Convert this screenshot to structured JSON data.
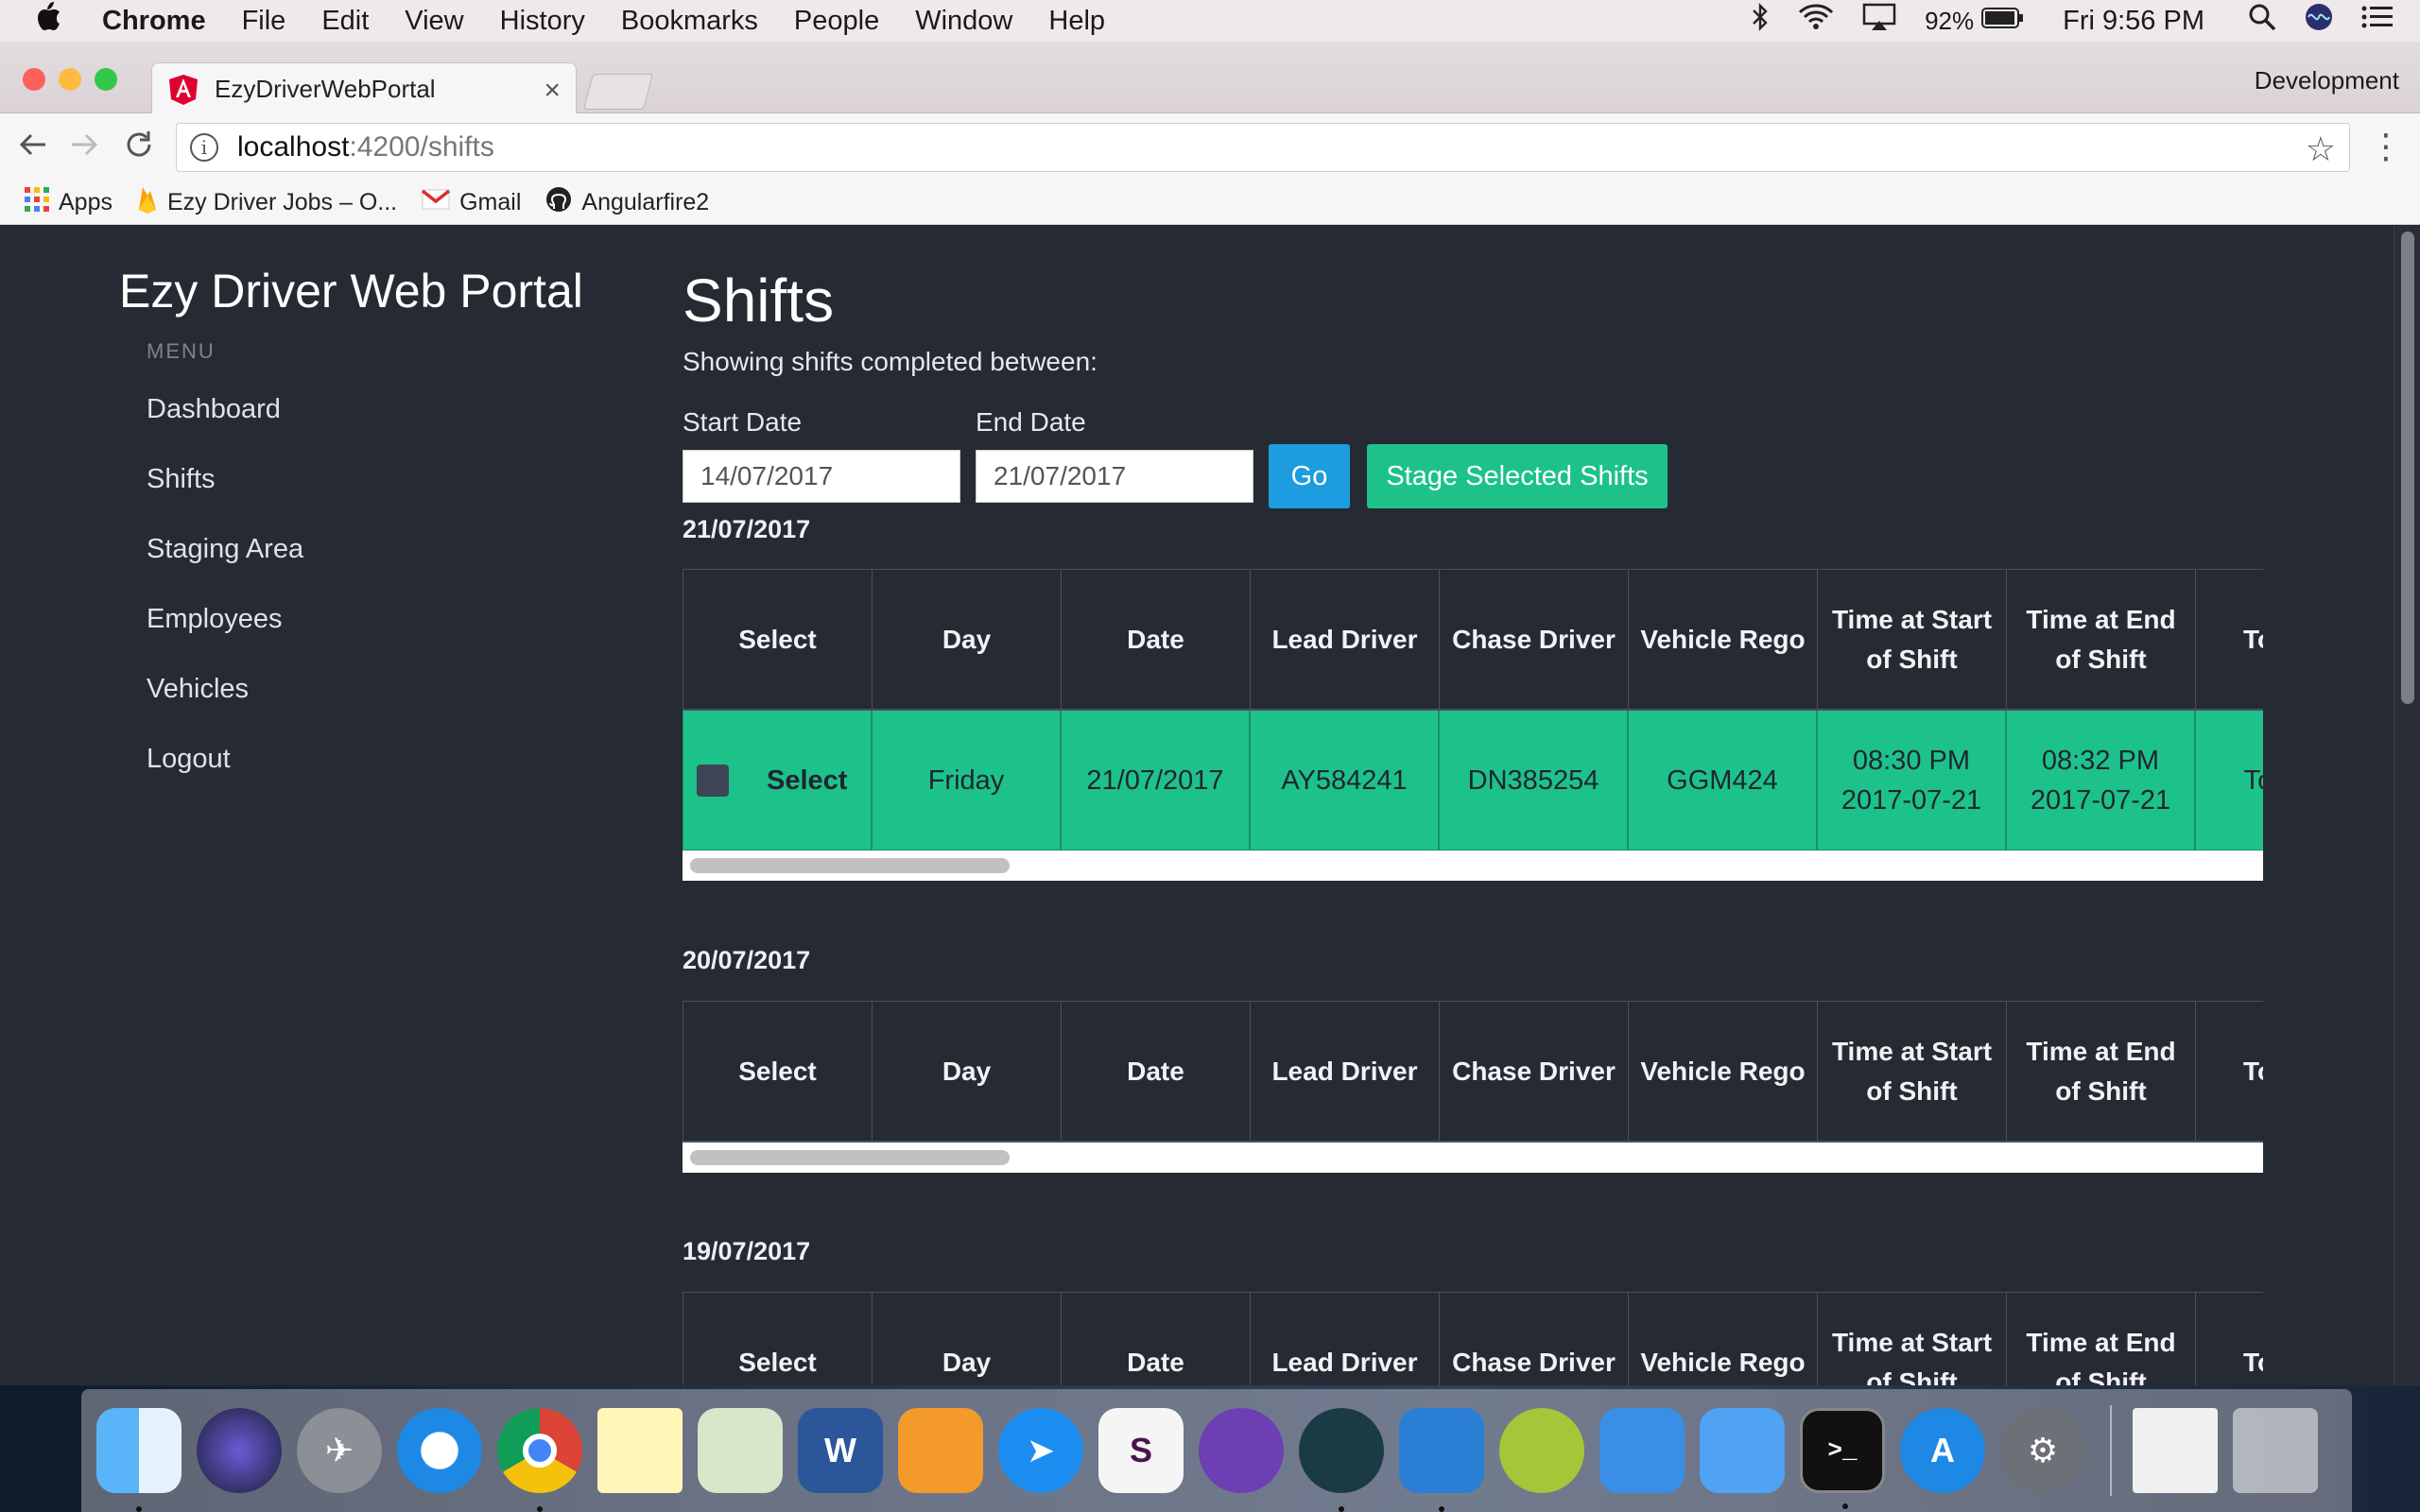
{
  "menubar": {
    "items": [
      "Chrome",
      "File",
      "Edit",
      "View",
      "History",
      "Bookmarks",
      "People",
      "Window",
      "Help"
    ],
    "battery": "92%",
    "clock": "Fri 9:56 PM"
  },
  "browser": {
    "tab_title": "EzyDriverWebPortal",
    "profile": "Development",
    "url_host": "localhost",
    "url_path": ":4200/shifts",
    "bookmarks": [
      "Apps",
      "Ezy Driver Jobs – O...",
      "Gmail",
      "Angularfire2"
    ]
  },
  "sidebar": {
    "brand": "Ezy Driver Web Portal",
    "menu_title": "MENU",
    "items": [
      "Dashboard",
      "Shifts",
      "Staging Area",
      "Employees",
      "Vehicles",
      "Logout"
    ]
  },
  "main": {
    "title": "Shifts",
    "subtitle": "Showing shifts completed between:",
    "start_label": "Start Date",
    "end_label": "End Date",
    "start_value": "14/07/2017",
    "end_value": "21/07/2017",
    "go_label": "Go",
    "stage_label": "Stage Selected Shifts",
    "columns": [
      "Select",
      "Day",
      "Date",
      "Lead Driver",
      "Chase Driver",
      "Vehicle Rego",
      "Time at Start of Shift",
      "Time at End of Shift",
      "Total W"
    ],
    "groups": [
      {
        "date": "21/07/2017",
        "rows": [
          {
            "select": "Select",
            "day": "Friday",
            "date": "21/07/2017",
            "lead": "AY584241",
            "chase": "DN385254",
            "rego": "GGM424",
            "start_time": "08:30 PM",
            "start_date": "2017-07-21",
            "end_time": "08:32 PM",
            "end_date": "2017-07-21",
            "total": "Total W"
          }
        ]
      },
      {
        "date": "20/07/2017",
        "rows": []
      },
      {
        "date": "19/07/2017",
        "rows": []
      }
    ]
  },
  "colors": {
    "page_bg": "#262a33",
    "accent_green": "#1dc28a",
    "accent_blue": "#1e9ce0"
  }
}
